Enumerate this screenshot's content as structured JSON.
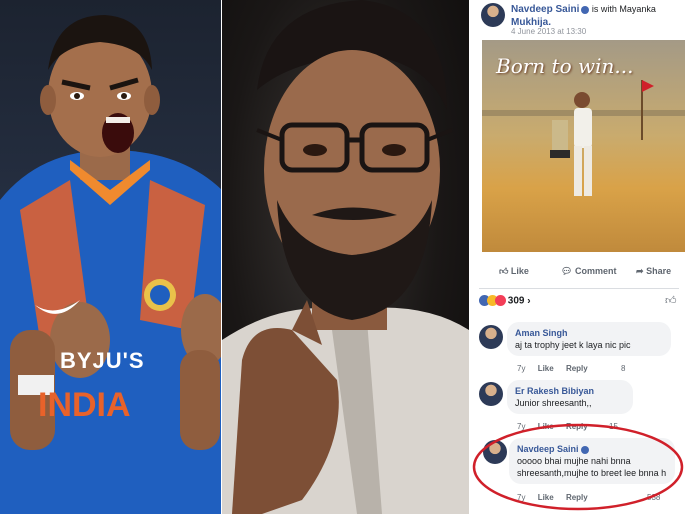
{
  "post": {
    "author": "Navdeep Saini",
    "with_text": "is with Mayanka",
    "with_text_2": "Mukhija.",
    "date": "4 June 2013 at 13:30",
    "image_caption": "Born to win...",
    "actions": {
      "like": "Like",
      "comment": "Comment",
      "share": "Share"
    },
    "reaction_count": "309",
    "more_chevron": "›"
  },
  "comments": [
    {
      "name": "Aman Singh",
      "text": "aj ta trophy jeet k laya nic pic",
      "age": "7y",
      "like": "Like",
      "reply": "Reply",
      "reactions": "8"
    },
    {
      "name": "Er Rakesh Bibiyan",
      "text": "Junior shreesanth,,",
      "age": "7y",
      "like": "Like",
      "reply": "Reply",
      "reactions": "15"
    },
    {
      "name": "Navdeep Saini",
      "text": "ooooo bhai mujhe nahi bnna shreesanth,mujhe to breet lee bnna h",
      "age": "7y",
      "like": "Like",
      "reply": "Reply",
      "reactions": "538"
    }
  ],
  "jersey": {
    "sponsor": "BYJU'S",
    "team": "INDIA"
  },
  "colors": {
    "fb_blue": "#385898",
    "highlight_red": "#d0202a",
    "jersey_blue": "#1f5fbf",
    "jersey_orange": "#e8622a"
  }
}
